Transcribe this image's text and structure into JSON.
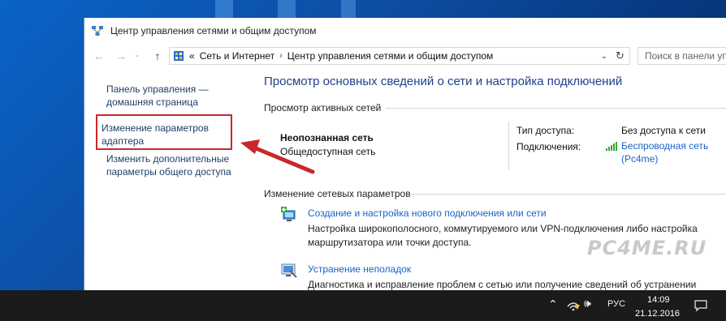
{
  "window": {
    "title": "Центр управления сетями и общим доступом"
  },
  "address": {
    "overflow": "«",
    "crumbs": [
      "Сеть и Интернет",
      "Центр управления сетями и общим доступом"
    ],
    "separator": "›",
    "search_placeholder": "Поиск в панели уп"
  },
  "sidebar": {
    "items": [
      {
        "label": "Панель управления — домашняя страница"
      },
      {
        "label": "Изменение параметров адаптера"
      },
      {
        "label": "Изменить дополнительные параметры общего доступа"
      }
    ]
  },
  "main": {
    "title": "Просмотр основных сведений о сети и настройка подключений",
    "active_networks_header": "Просмотр активных сетей",
    "network": {
      "name": "Неопознанная сеть",
      "category": "Общедоступная сеть",
      "access_type_label": "Тип доступа:",
      "access_type_value": "Без доступа к сети",
      "connections_label": "Подключения:",
      "connection_link": "Беспроводная сеть (Pc4me)"
    },
    "change_settings_header": "Изменение сетевых параметров",
    "tasks": [
      {
        "title": "Создание и настройка нового подключения или сети",
        "description": "Настройка широкополосного, коммутируемого или VPN-подключения либо настройка маршрутизатора или точки доступа.",
        "icon": "new-connection-icon"
      },
      {
        "title": "Устранение неполадок",
        "description": "Диагностика и исправление проблем с сетью или получение сведений об устранении неполадок.",
        "icon": "troubleshoot-icon"
      }
    ]
  },
  "watermark": "PC4ME.RU",
  "taskbar": {
    "language": "РУС",
    "time": "14:09",
    "date": "21.12.2016"
  },
  "colors": {
    "link": "#1a62c9",
    "title_blue": "#1e3f8a",
    "highlight": "#c8282c",
    "taskbar": "#1b1b1b"
  }
}
